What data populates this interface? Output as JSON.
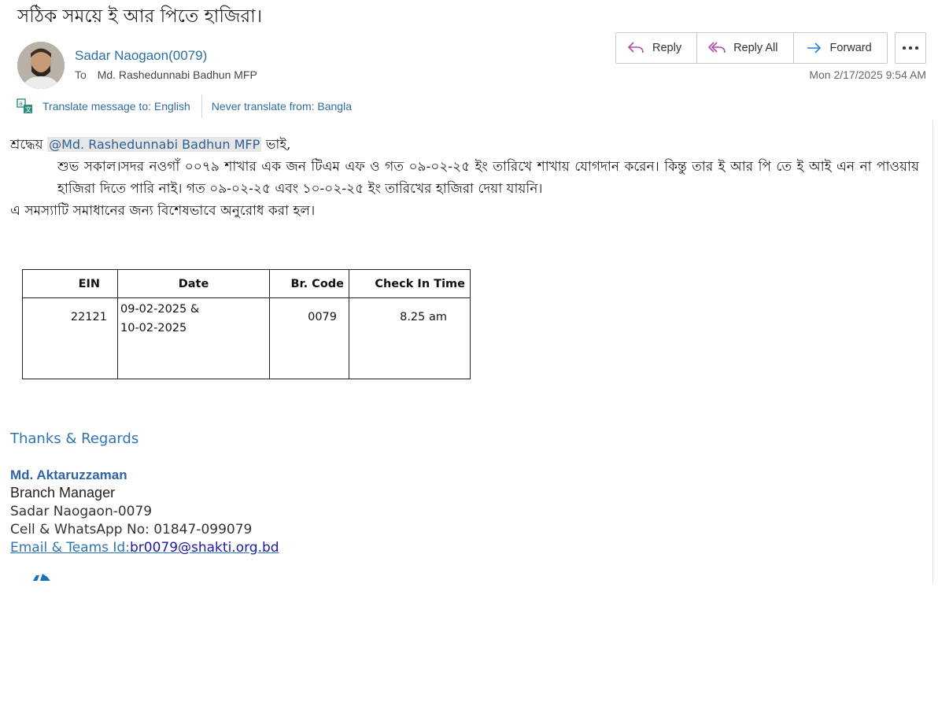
{
  "subject": "সঠিক সময়ে ই আর পিতে হাজিরা।",
  "sender": {
    "name": "Sadar Naogaon(0079)"
  },
  "recipient": {
    "to_label": "To",
    "name": "Md. Rashedunnabi Badhun MFP"
  },
  "actions": {
    "reply": "Reply",
    "reply_all": "Reply All",
    "forward": "Forward"
  },
  "date": "Mon 2/17/2025 9:54 AM",
  "translate": {
    "translate_to": "Translate message to: English",
    "never_translate": "Never translate from: Bangla"
  },
  "body": {
    "greeting_prefix": "শ্রদ্ধেয়",
    "mention": "@Md. Rashedunnabi Badhun MFP",
    "greeting_suffix": "ভাই,",
    "paragraph1": "শুভ সকাল।সদর নওগাঁ ০০৭৯ শাখার এক জন টিএম এফ ও গত ০৯-০২-২৫ ইং তারিখে শাখায় যোগদান করেন। কিন্তু তার ই আর পি তে ই আই এন না পাওয়ায় হাজিরা দিতে পারি নাই। গত ০৯-০২-২৫ এবং ১০-০২-২৫ ইং তারিখের হাজিরা দেয়া যায়নি।",
    "paragraph2": "এ সমস্যাটি সমাধানের জন্য বিশেষভাবে অনুরোধ করা হল।"
  },
  "table": {
    "headers": [
      "EIN",
      "Date",
      "Br. Code",
      "Check In Time"
    ],
    "row": {
      "ein": "22121",
      "date_line1": "09-02-2025 &",
      "date_line2": "10-02-2025",
      "br_code": "0079",
      "check_in": "8.25 am"
    }
  },
  "signature": {
    "thanks": "Thanks & Regards",
    "name": "Md. Aktaruzzaman",
    "title": "Branch Manager",
    "branch": "Sadar Naogaon-0079",
    "cell": "Cell & WhatsApp No: 01847-099079",
    "email_label": "Email & Teams Id:",
    "email": "br0079@shakti.org.bd"
  },
  "colors": {
    "link": "#2d6fa3",
    "signature_name": "#2e63a8",
    "reply_icon": "#b04aa5",
    "forward_icon": "#2a7ed4"
  },
  "icons": [
    "reply-icon",
    "reply-all-icon",
    "forward-icon",
    "more-icon",
    "translate-icon"
  ]
}
